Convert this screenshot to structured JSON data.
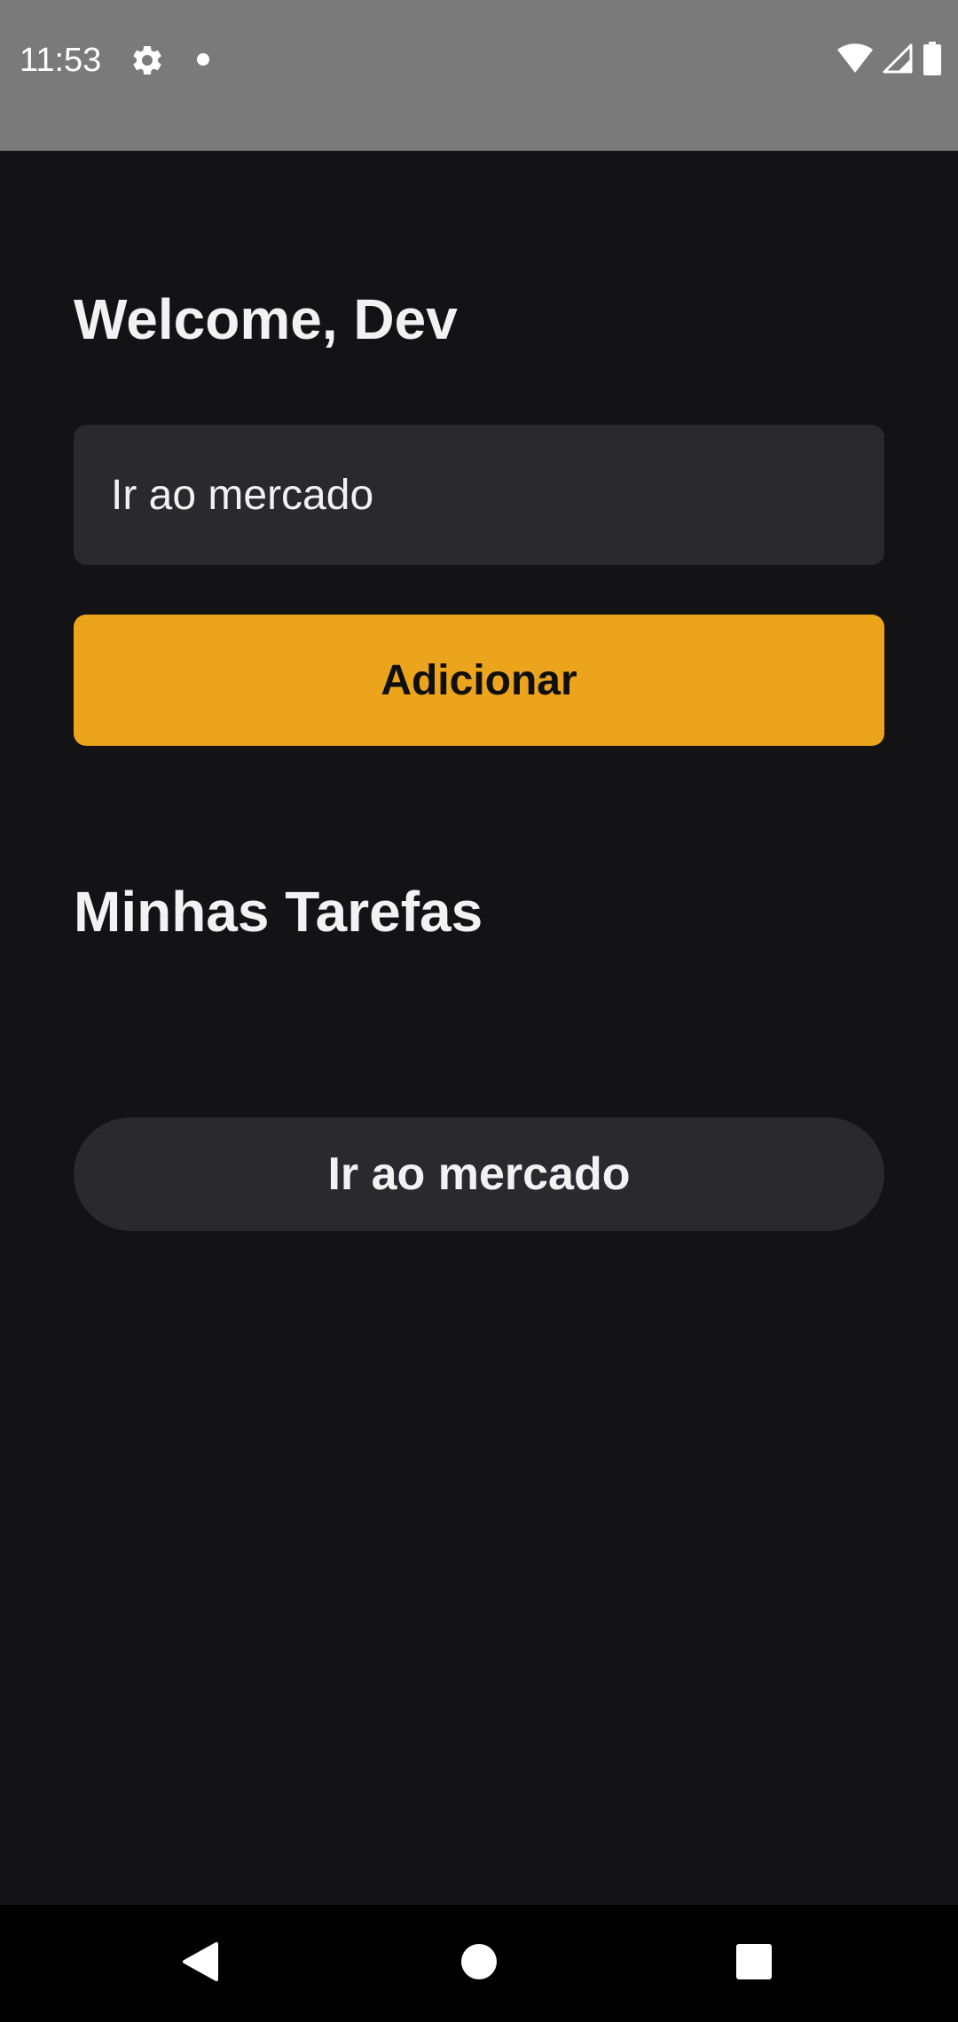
{
  "status_bar": {
    "time": "11:53",
    "icons": [
      "gear-icon",
      "notification-dot-icon",
      "wifi-icon",
      "cell-signal-icon",
      "battery-icon"
    ]
  },
  "main": {
    "welcome": "Welcome, Dev",
    "task_input": {
      "value": "Ir ao mercado",
      "placeholder": ""
    },
    "add_button_label": "Adicionar",
    "section_title": "Minhas Tarefas",
    "tasks": [
      {
        "label": "Ir ao mercado"
      }
    ]
  },
  "navigation_bar": {
    "icons": [
      "back-icon",
      "home-icon",
      "recents-icon"
    ]
  },
  "colors": {
    "background": "#131316",
    "surface": "#29292e",
    "accent": "#eba41b",
    "text": "#f2f2f2",
    "status_bar": "#7a7a7a",
    "navigation_bar": "#000000"
  }
}
